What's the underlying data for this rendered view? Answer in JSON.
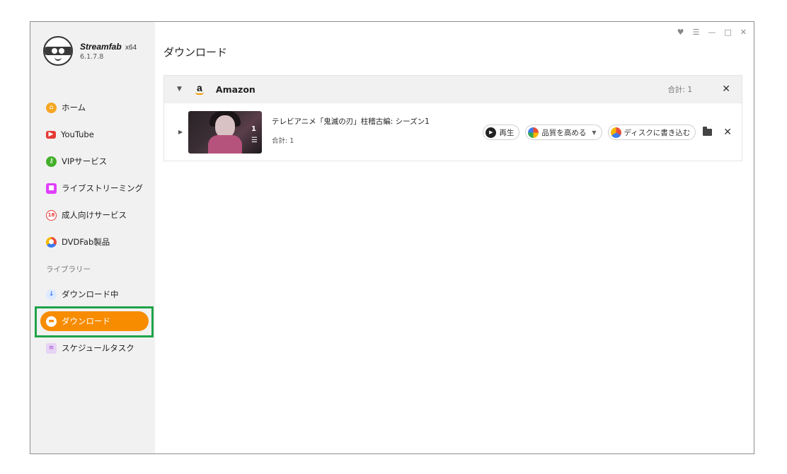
{
  "app": {
    "name": "Streamfab",
    "arch": "x64",
    "version": "6.1.7.8"
  },
  "window_controls": [
    "♥",
    "☰",
    "—",
    "□",
    "✕"
  ],
  "sidebar": {
    "items": [
      {
        "label": "ホーム",
        "icon": "home-icon",
        "color": "#f5a623"
      },
      {
        "label": "YouTube",
        "icon": "youtube-icon",
        "color": "#e53935"
      },
      {
        "label": "VIPサービス",
        "icon": "key-icon",
        "color": "#43b02a"
      },
      {
        "label": "ライブストリーミング",
        "icon": "video-camera-icon",
        "color": "#e040fb"
      },
      {
        "label": "成人向けサービス",
        "icon": "adult-18-icon",
        "color": "#e53935"
      },
      {
        "label": "DVDFab製品",
        "icon": "dvdfab-icon",
        "color": "#3c7bf0"
      }
    ],
    "library_label": "ライブラリー",
    "library": [
      {
        "label": "ダウンロード中",
        "icon": "download-arrow-icon",
        "color": "#3c7bf0"
      },
      {
        "label": "ダウンロード",
        "icon": "folder-icon",
        "active": true,
        "color": "#f78c00"
      },
      {
        "label": "スケジュールタスク",
        "icon": "schedule-list-icon",
        "color": "#9c4dcc"
      }
    ]
  },
  "main": {
    "title": "ダウンロード",
    "group": {
      "name": "Amazon",
      "total": "合計: 1",
      "items": [
        {
          "title": "テレビアニメ「鬼滅の刃」柱稽古編: シーズン1",
          "total": "合計: 1",
          "thumb_count": "1",
          "actions": {
            "play": "再生",
            "quality": "品質を高める",
            "burn": "ディスクに書き込む"
          }
        }
      ]
    }
  },
  "colors": {
    "accent": "#f78c00",
    "highlight_box": "#1fa34a"
  }
}
